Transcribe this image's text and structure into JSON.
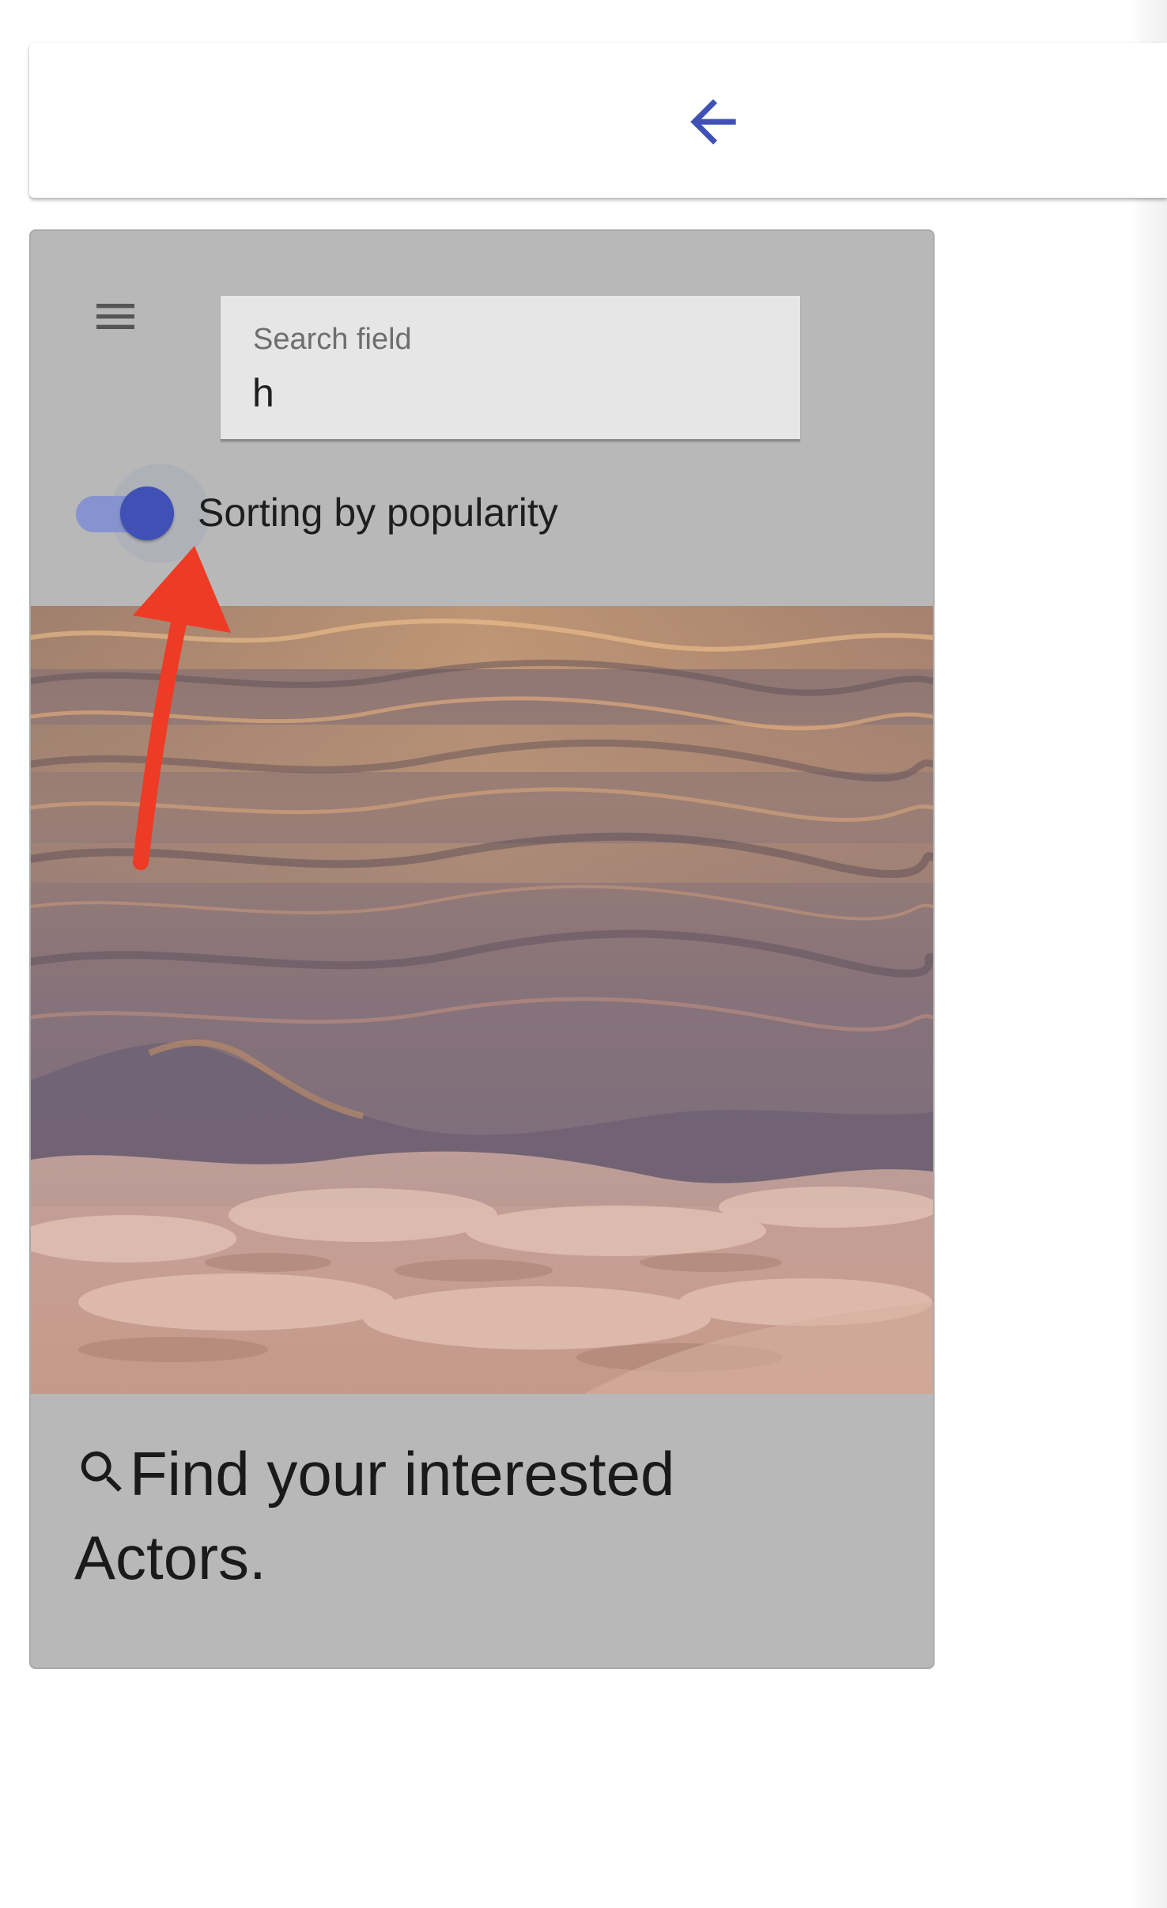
{
  "top_bar": {
    "back_icon": "arrow-left-icon",
    "accent_color": "#3f51b5"
  },
  "card": {
    "menu_icon": "hamburger-menu-icon",
    "search": {
      "label": "Search field",
      "value": "h"
    },
    "sort_switch": {
      "label": "Sorting by popularity",
      "checked": true,
      "color": "#3f51b5"
    },
    "image": {
      "subject": "ocean waves at sunset"
    },
    "caption": {
      "icon": "search-icon",
      "text": "Find your interested Actors."
    }
  },
  "annotation": {
    "type": "red arrow pointing at sort switch",
    "color": "#ee3b25"
  }
}
